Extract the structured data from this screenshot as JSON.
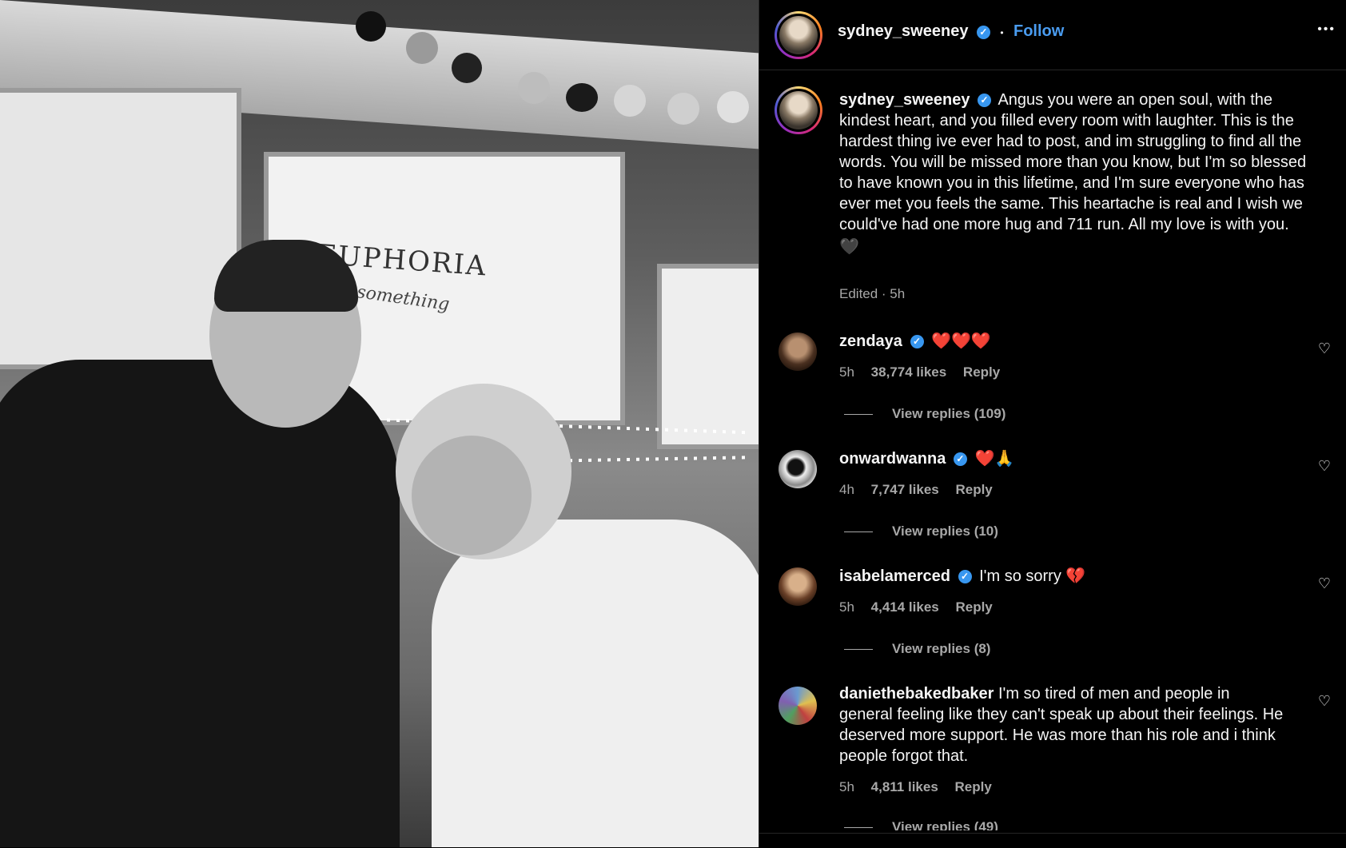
{
  "header": {
    "username": "sydney_sweeney",
    "verified": "✓",
    "separator": "•",
    "follow_label": "Follow",
    "more_label": "•••"
  },
  "caption": {
    "username": "sydney_sweeney",
    "text": "Angus you were an open soul, with the kindest heart, and you filled every room with laughter. This is the hardest thing ive ever had to post, and im struggling to find all the words. You will be missed more than you know, but I'm so blessed to have known you in this lifetime, and I'm sure everyone who has ever met you feels the same. This heartache is real and I wish we could've had one more hug and 711 run. All my love is with you.",
    "emoji": "🖤",
    "meta": "Edited · 5h"
  },
  "comments": [
    {
      "username": "zendaya",
      "text": "❤️❤️❤️",
      "time": "5h",
      "likes": "38,774 likes",
      "reply": "Reply",
      "view_replies": "View replies (109)"
    },
    {
      "username": "onwardwanna",
      "text": "❤️🙏",
      "time": "4h",
      "likes": "7,747 likes",
      "reply": "Reply",
      "view_replies": "View replies (10)"
    },
    {
      "username": "isabelamerced",
      "text": "I'm so sorry 💔",
      "time": "5h",
      "likes": "4,414 likes",
      "reply": "Reply",
      "view_replies": "View replies (8)"
    },
    {
      "username": "daniethebakedbaker",
      "text": "I'm so tired of men and people in general feeling like they can't speak up about their feelings. He deserved more support. He was more than his role and i think people forgot that.",
      "time": "5h",
      "likes": "4,811 likes",
      "reply": "Reply",
      "view_replies": "View replies (49)"
    }
  ],
  "icons": {
    "heart": "♡"
  },
  "photo": {
    "sign_text": "EUPHORIA",
    "sign_sub": "something",
    "colors": {
      "brand_blue": "#4a9cf0",
      "verified_blue": "#3897f0"
    }
  }
}
